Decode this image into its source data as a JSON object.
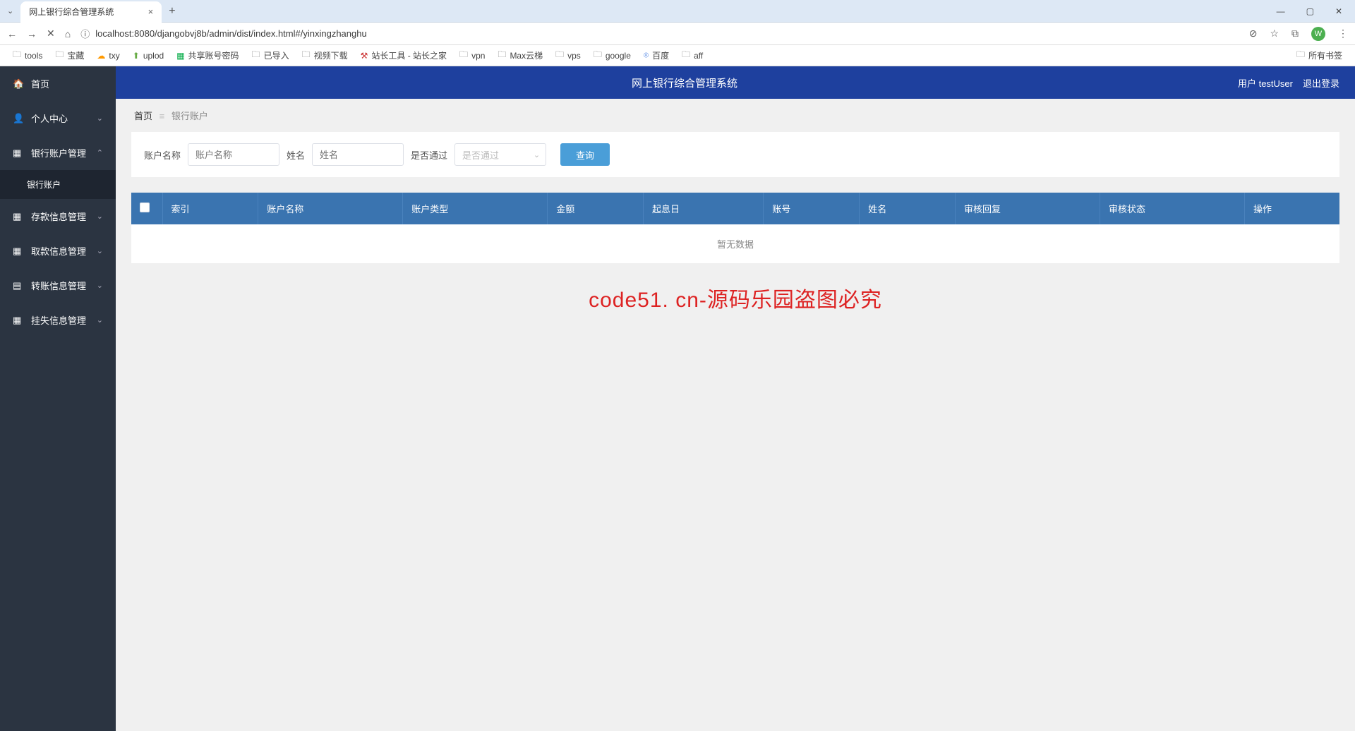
{
  "browser": {
    "tab_title": "网上银行综合管理系统",
    "url": "localhost:8080/djangobvj8b/admin/dist/index.html#/yinxingzhanghu",
    "avatar_letter": "W"
  },
  "bookmarks": [
    {
      "label": "tools"
    },
    {
      "label": "宝藏"
    },
    {
      "label": "txy"
    },
    {
      "label": "uplod"
    },
    {
      "label": "共享账号密码"
    },
    {
      "label": "已导入"
    },
    {
      "label": "视频下载"
    },
    {
      "label": "站长工具 - 站长之家"
    },
    {
      "label": "vpn"
    },
    {
      "label": "Max云梯"
    },
    {
      "label": "vps"
    },
    {
      "label": "google"
    },
    {
      "label": "百度"
    },
    {
      "label": "aff"
    }
  ],
  "bookmark_all": "所有书签",
  "sidebar": {
    "items": [
      {
        "label": "首页"
      },
      {
        "label": "个人中心"
      },
      {
        "label": "银行账户管理"
      },
      {
        "label": "存款信息管理"
      },
      {
        "label": "取款信息管理"
      },
      {
        "label": "转账信息管理"
      },
      {
        "label": "挂失信息管理"
      }
    ],
    "submenu": "银行账户"
  },
  "header": {
    "title": "网上银行综合管理系统",
    "user_label": "用户 testUser",
    "logout": "退出登录"
  },
  "breadcrumb": {
    "home": "首页",
    "current": "银行账户"
  },
  "search": {
    "account_name_label": "账户名称",
    "account_name_placeholder": "账户名称",
    "name_label": "姓名",
    "name_placeholder": "姓名",
    "approved_label": "是否通过",
    "approved_placeholder": "是否通过",
    "query_btn": "查询"
  },
  "table": {
    "columns": [
      "索引",
      "账户名称",
      "账户类型",
      "金额",
      "起息日",
      "账号",
      "姓名",
      "审核回复",
      "审核状态",
      "操作"
    ],
    "empty": "暂无数据"
  },
  "watermark": "code51. cn-源码乐园盗图必究"
}
